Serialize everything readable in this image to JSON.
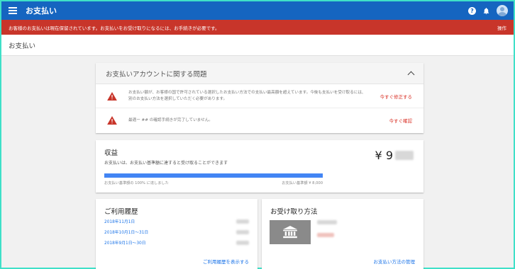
{
  "topbar": {
    "title": "お支払い",
    "icons": [
      "menu-icon",
      "help-icon",
      "bell-icon",
      "avatar"
    ],
    "help_glyph": "?"
  },
  "alert": {
    "message": "お客様のお支払いは現在保留されています。お支払いをお受け取りになるには、お手続きが必要です。",
    "action": "操作",
    "color": "#c8352a"
  },
  "page_title": "お支払い",
  "issues": {
    "title": "お支払いアカウントに関する問題",
    "items": [
      {
        "text": "お支払い額が、お客様の国で許可されている選択したお支払い方法での支払い最高額を超えています。今後も支払いを受け取るには、別のお支払い方法を選択していただく必要があります。",
        "link": "今すぐ修正する"
      },
      {
        "text": "最適ー ## の確認手続きが完了していません。",
        "link": "今すぐ確認"
      }
    ]
  },
  "earnings": {
    "title": "収益",
    "description": "お支払いは、お支払い基準額に達すると受け取ることができます",
    "amount_prefix": "¥ 9",
    "progress_percent": 100,
    "progress_left_label": "お支払い基準額の 100% に達しました",
    "progress_right_label": "お支払い基準額 ¥ 8,000"
  },
  "history": {
    "title": "ご利用履歴",
    "rows": [
      {
        "date": "2018年11月1日"
      },
      {
        "date": "2018年10月1日～31日"
      },
      {
        "date": "2018年9月1日～30日"
      }
    ],
    "link": "ご利用履歴を表示する"
  },
  "payment": {
    "title": "お受け取り方法",
    "link": "お支払い方法の管理",
    "icon": "bank-icon"
  },
  "colors": {
    "topbar": "#1565c0",
    "alert": "#c8352a",
    "link": "#1a73e8",
    "warning": "#d93025",
    "progress": "#4285f4"
  }
}
